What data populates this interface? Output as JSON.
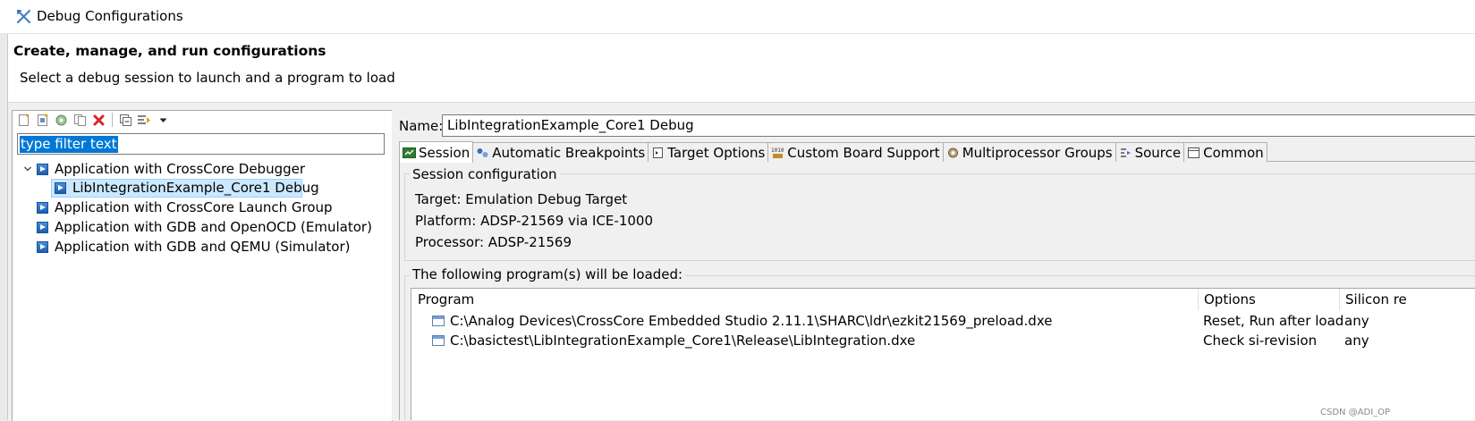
{
  "window": {
    "title": "Debug Configurations"
  },
  "header": {
    "title": "Create, manage, and run configurations",
    "subtitle": "Select a debug session to launch and a program to load"
  },
  "left_pane": {
    "toolbar": [
      "new-config-icon",
      "new-prototype-icon",
      "export-icon",
      "duplicate-icon",
      "delete-icon",
      "collapse-all-icon",
      "filter-icon",
      "dropdown-arrow-icon"
    ],
    "filter_text": "type filter text",
    "tree": [
      {
        "label": "Application with CrossCore Debugger",
        "expanded": true,
        "children": [
          {
            "label": "LibIntegrationExample_Core1 Debug",
            "selected": true
          }
        ]
      },
      {
        "label": "Application with CrossCore Launch Group"
      },
      {
        "label": "Application with GDB and OpenOCD (Emulator)"
      },
      {
        "label": "Application with GDB and QEMU (Simulator)"
      }
    ]
  },
  "right_pane": {
    "name_label": "Name:",
    "name_value": "LibIntegrationExample_Core1 Debug",
    "tabs": [
      {
        "label": "Session",
        "active": true
      },
      {
        "label": "Automatic Breakpoints"
      },
      {
        "label": "Target Options"
      },
      {
        "label": "Custom Board Support"
      },
      {
        "label": "Multiprocessor Groups"
      },
      {
        "label": "Source"
      },
      {
        "label": "Common"
      }
    ],
    "session_group": {
      "title": "Session configuration",
      "target": "Target: Emulation Debug Target",
      "platform": "Platform: ADSP-21569 via ICE-1000",
      "processor": "Processor: ADSP-21569"
    },
    "programs_group": {
      "title": "The following program(s) will be loaded:",
      "columns": [
        "Program",
        "Options",
        "Silicon re"
      ],
      "rows": [
        {
          "program": "C:\\Analog Devices\\CrossCore Embedded Studio 2.11.1\\SHARC\\ldr\\ezkit21569_preload.dxe",
          "options": "Reset, Run after load",
          "silicon": "any"
        },
        {
          "program": "C:\\basictest\\LibIntegrationExample_Core1\\Release\\LibIntegration.dxe",
          "options": "Check si-revision",
          "silicon": "any"
        }
      ]
    }
  },
  "watermark": "CSDN @ADI_OP"
}
